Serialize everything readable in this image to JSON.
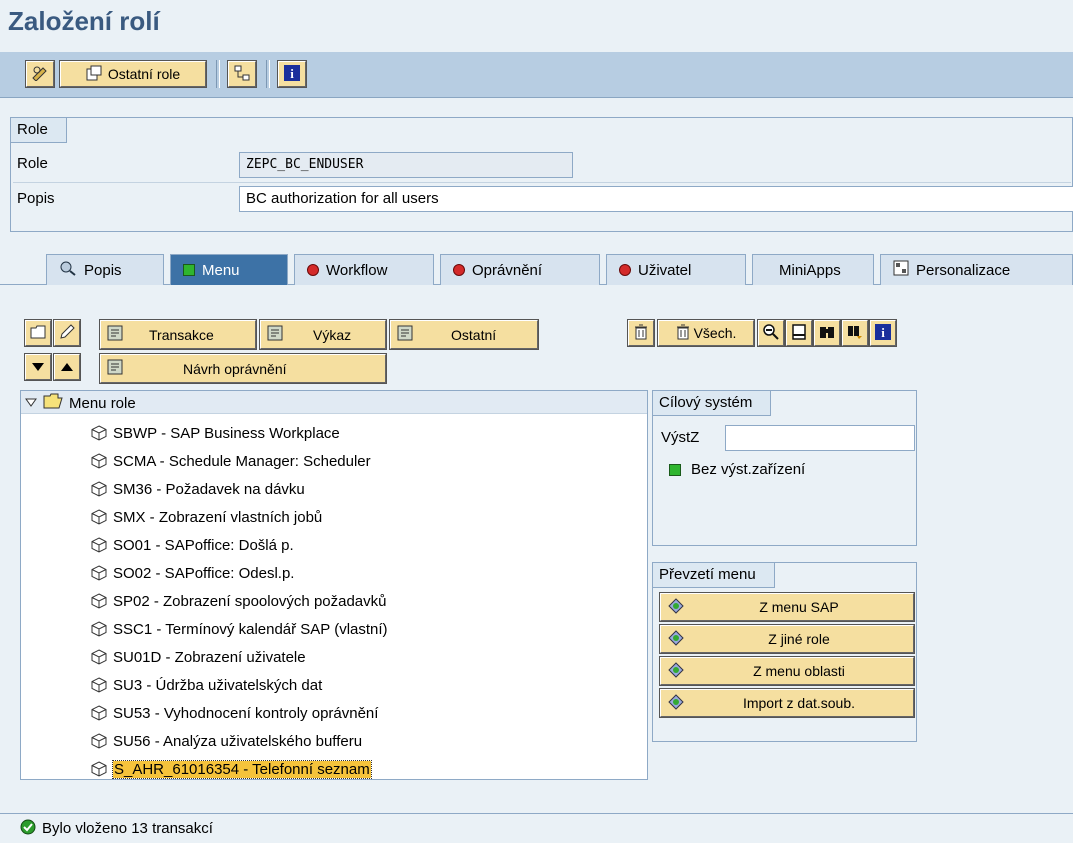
{
  "window": {
    "title": "Založení rolí"
  },
  "toolbar": {
    "other_roles_label": "Ostatní role"
  },
  "role_group": {
    "title": "Role",
    "role_label": "Role",
    "role_value": "ZEPC_BC_ENDUSER",
    "desc_label": "Popis",
    "desc_value": "BC authorization for all users"
  },
  "tabs": [
    {
      "label": "Popis",
      "icon": "magnifier-icon"
    },
    {
      "label": "Menu",
      "icon": "green-status-icon",
      "active": true
    },
    {
      "label": "Workflow",
      "icon": "red-status-icon"
    },
    {
      "label": "Oprávnění",
      "icon": "red-status-icon"
    },
    {
      "label": "Uživatel",
      "icon": "red-status-icon"
    },
    {
      "label": "MiniApps",
      "icon": ""
    },
    {
      "label": "Personalizace",
      "icon": "personalization-icon"
    }
  ],
  "menu_toolbar": {
    "transaction_label": "Transakce",
    "report_label": "Výkaz",
    "other_label": "Ostatní",
    "auth_proposal_label": "Návrh oprávnění",
    "delete_all_label": "Všech."
  },
  "tree": {
    "root_label": "Menu role",
    "items": [
      "SBWP - SAP Business Workplace",
      "SCMA - Schedule Manager: Scheduler",
      "SM36 - Požadavek na dávku",
      "SMX - Zobrazení vlastních jobů",
      "SO01 - SAPoffice: Došlá p.",
      "SO02 - SAPoffice: Odesl.p.",
      "SP02 - Zobrazení spoolových požadavků",
      "SSC1 - Termínový kalendář SAP (vlastní)",
      "SU01D - Zobrazení uživatele",
      "SU3 - Údržba uživatelských dat",
      "SU53 - Vyhodnocení kontroly oprávnění",
      "SU56 - Analýza uživatelského bufferu",
      "S_AHR_61016354 - Telefonní seznam"
    ],
    "selected_index": 12
  },
  "target_system": {
    "title": "Cílový systém",
    "label": "VýstZ",
    "value": "",
    "status_text": "Bez výst.zařízení"
  },
  "menu_transfer": {
    "title": "Převzetí menu",
    "buttons": [
      "Z menu SAP",
      "Z jiné role",
      "Z menu oblasti",
      "Import z dat.soub."
    ]
  },
  "status_bar": {
    "message": "Bylo vloženo 13 transakcí"
  },
  "colors": {
    "title": "#3a5a80",
    "button": "#f5dfa0",
    "active_tab": "#3d72a6",
    "selection": "#f5c33b"
  }
}
